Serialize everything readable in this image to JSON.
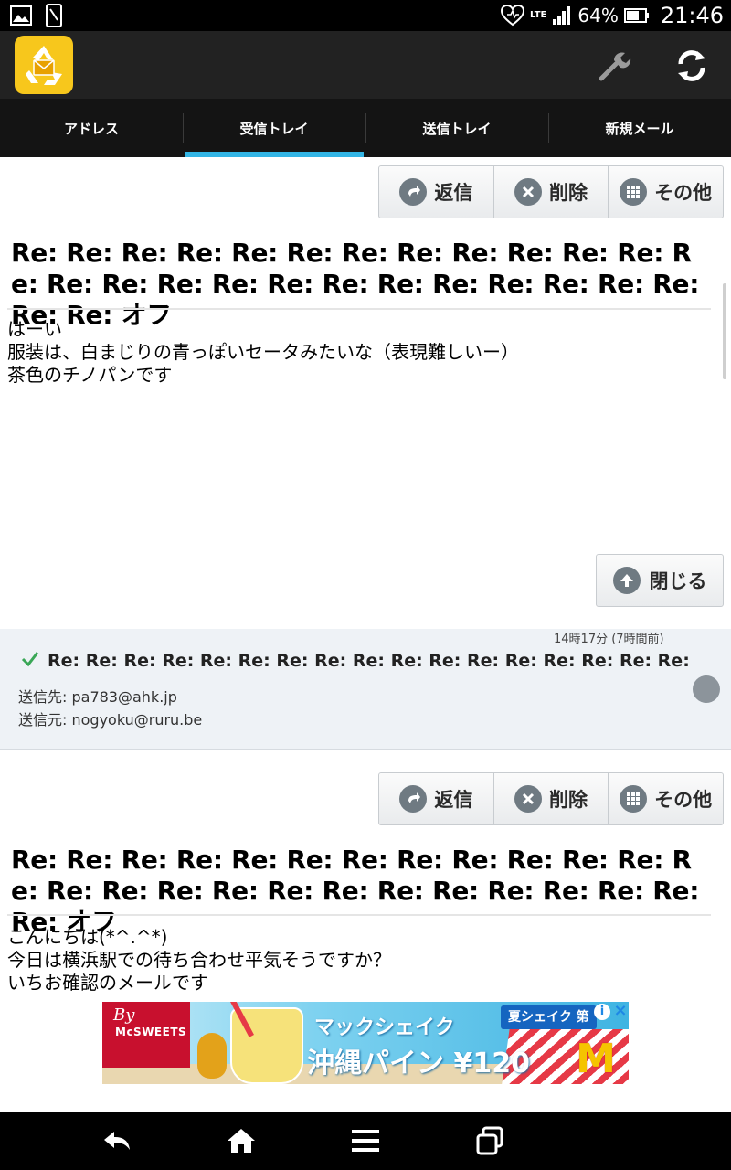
{
  "status_bar": {
    "battery": "64%",
    "network": "LTE",
    "time": "21:46"
  },
  "tabs": [
    {
      "label": "アドレス",
      "active": false
    },
    {
      "label": "受信トレイ",
      "active": true
    },
    {
      "label": "送信トレイ",
      "active": false
    },
    {
      "label": "新規メール",
      "active": false
    }
  ],
  "actions": {
    "reply": "返信",
    "delete": "削除",
    "more": "その他",
    "close": "閉じる"
  },
  "message_1": {
    "subject": "Re: Re: Re: Re: Re: Re: Re: Re: Re: Re: Re: Re: Re: Re: Re: Re: Re: Re: Re: Re: Re: Re: Re: Re: Re: Re: Re: オフ",
    "body": "はーい\n服装は、白まじりの青っぽいセータみたいな（表現難しいー）\n茶色のチノパンです"
  },
  "mail_item": {
    "time": "14時17分 (7時間前)",
    "subject": "Re: Re: Re: Re: Re: Re: Re: Re: Re: Re: Re: Re: Re: Re: Re: Re: Re: Re: Re: Re:",
    "to": "送信先: pa783@ahk.jp",
    "from": "送信元: nogyoku@ruru.be"
  },
  "message_2": {
    "subject": "Re: Re: Re: Re: Re: Re: Re: Re: Re: Re: Re: Re: Re: Re: Re: Re: Re: Re: Re: Re: Re: Re: Re: Re: Re: Re: オフ",
    "body": "こんにちは(*^.^*)\n今日は横浜駅での待ち合わせ平気そうですか？\nいちお確認のメールです"
  },
  "ad": {
    "brand_line1": "By",
    "brand_line2": "McSWEETS",
    "title": "マックシェイク",
    "main": "沖縄パイン ¥120",
    "badge": "夏シェイク 第",
    "logo": "M"
  },
  "colors": {
    "accent": "#33b5e5",
    "app_bar": "#222222",
    "tab_bar": "#141414",
    "list_bg": "#eef2f6"
  }
}
